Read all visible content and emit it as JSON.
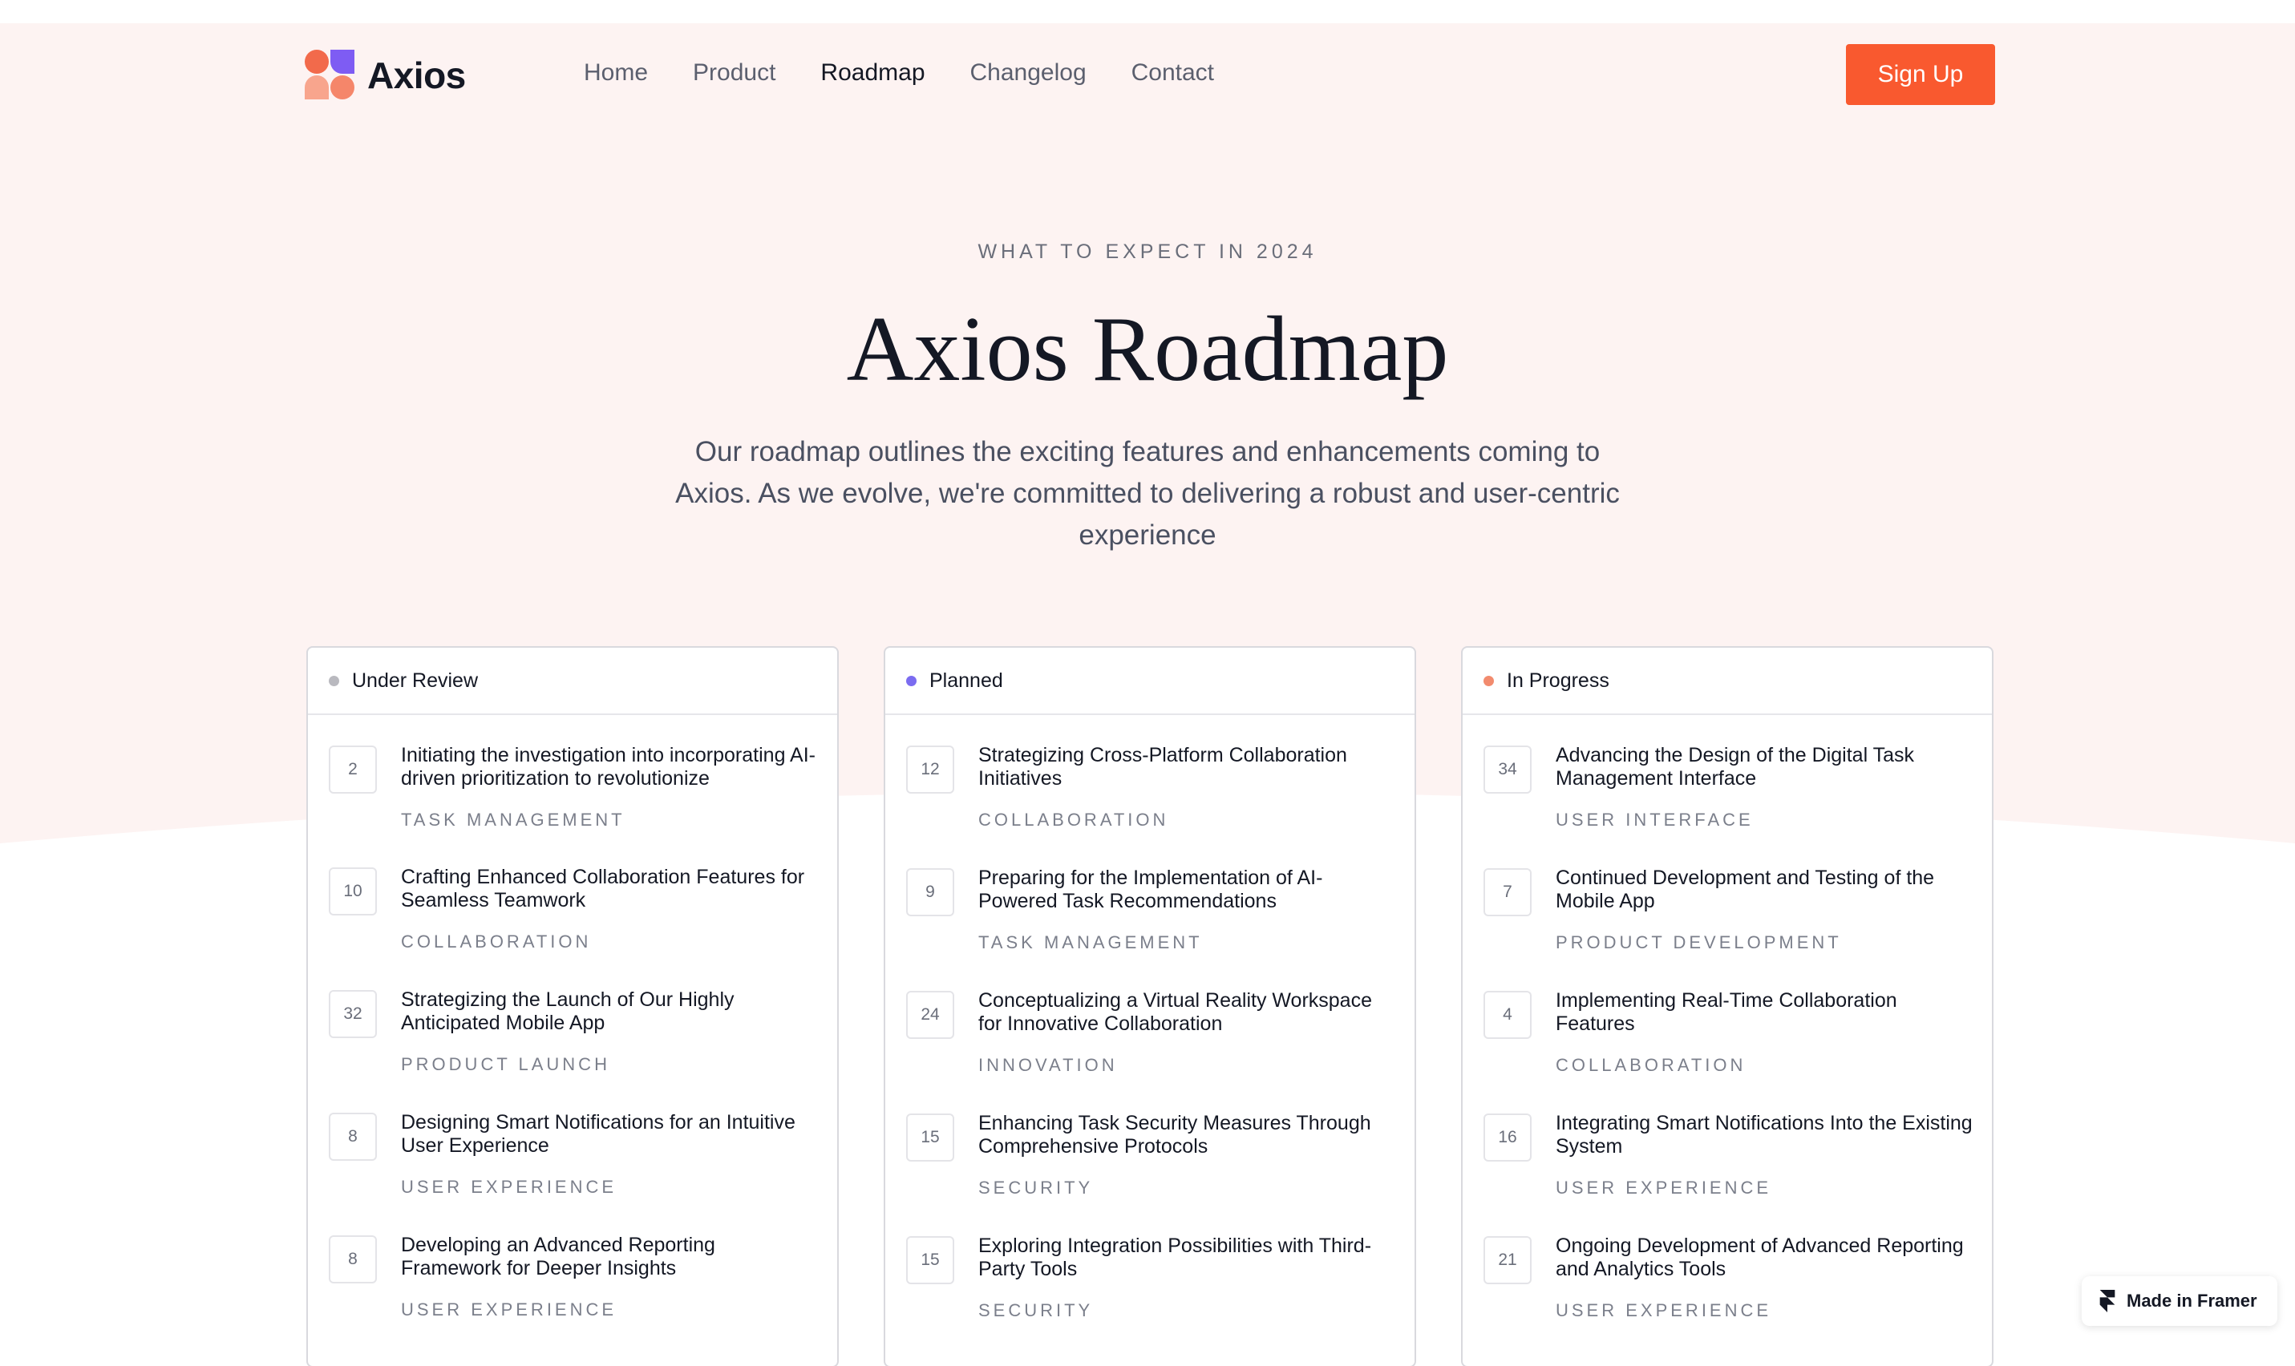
{
  "nav": {
    "brand": "Axios",
    "links": [
      {
        "label": "Home"
      },
      {
        "label": "Product"
      },
      {
        "label": "Roadmap"
      },
      {
        "label": "Changelog"
      },
      {
        "label": "Contact"
      }
    ],
    "active": "Roadmap",
    "signup_label": "Sign Up"
  },
  "hero": {
    "eyebrow": "WHAT TO EXPECT IN 2024",
    "title": "Axios Roadmap",
    "lede": "Our roadmap outlines the exciting features and enhancements coming to Axios. As we evolve, we're committed to delivering a robust and user-centric experience"
  },
  "columns": [
    {
      "title": "Under Review",
      "dot_color": "#b9b9bf",
      "items": [
        {
          "count": "2",
          "title": "Initiating the investigation into incorporating AI-driven prioritization to revolutionize",
          "tag": "TASK MANAGEMENT"
        },
        {
          "count": "10",
          "title": "Crafting Enhanced Collaboration Features for Seamless Teamwork",
          "tag": "COLLABORATION"
        },
        {
          "count": "32",
          "title": "Strategizing the Launch of Our Highly Anticipated Mobile App",
          "tag": "PRODUCT LAUNCH"
        },
        {
          "count": "8",
          "title": "Designing Smart Notifications for an Intuitive User Experience",
          "tag": "USER EXPERIENCE"
        },
        {
          "count": "8",
          "title": "Developing an Advanced Reporting Framework for Deeper Insights",
          "tag": "USER EXPERIENCE"
        }
      ]
    },
    {
      "title": "Planned",
      "dot_color": "#7b6cf0",
      "items": [
        {
          "count": "12",
          "title": "Strategizing Cross-Platform Collaboration Initiatives",
          "tag": "COLLABORATION"
        },
        {
          "count": "9",
          "title": "Preparing for the Implementation of AI-Powered Task Recommendations",
          "tag": "TASK MANAGEMENT"
        },
        {
          "count": "24",
          "title": "Conceptualizing a Virtual Reality Workspace for Innovative Collaboration",
          "tag": "INNOVATION"
        },
        {
          "count": "15",
          "title": "Enhancing Task Security Measures Through Comprehensive Protocols",
          "tag": "SECURITY"
        },
        {
          "count": "15",
          "title": "Exploring Integration Possibilities with Third-Party Tools",
          "tag": "SECURITY"
        }
      ]
    },
    {
      "title": "In Progress",
      "dot_color": "#f28b6e",
      "items": [
        {
          "count": "34",
          "title": "Advancing the Design of the Digital Task Management Interface",
          "tag": "USER INTERFACE"
        },
        {
          "count": "7",
          "title": "Continued Development and Testing of the Mobile App",
          "tag": "PRODUCT DEVELOPMENT"
        },
        {
          "count": "4",
          "title": "Implementing Real-Time Collaboration Features",
          "tag": "COLLABORATION"
        },
        {
          "count": "16",
          "title": "Integrating Smart Notifications Into the Existing System",
          "tag": "USER EXPERIENCE"
        },
        {
          "count": "21",
          "title": "Ongoing Development of Advanced Reporting and Analytics Tools",
          "tag": "USER EXPERIENCE"
        }
      ]
    }
  ],
  "badge": {
    "label": "Made in Framer"
  },
  "colors": {
    "accent": "#f9592f",
    "hero_bg": "#fdf3f2"
  }
}
